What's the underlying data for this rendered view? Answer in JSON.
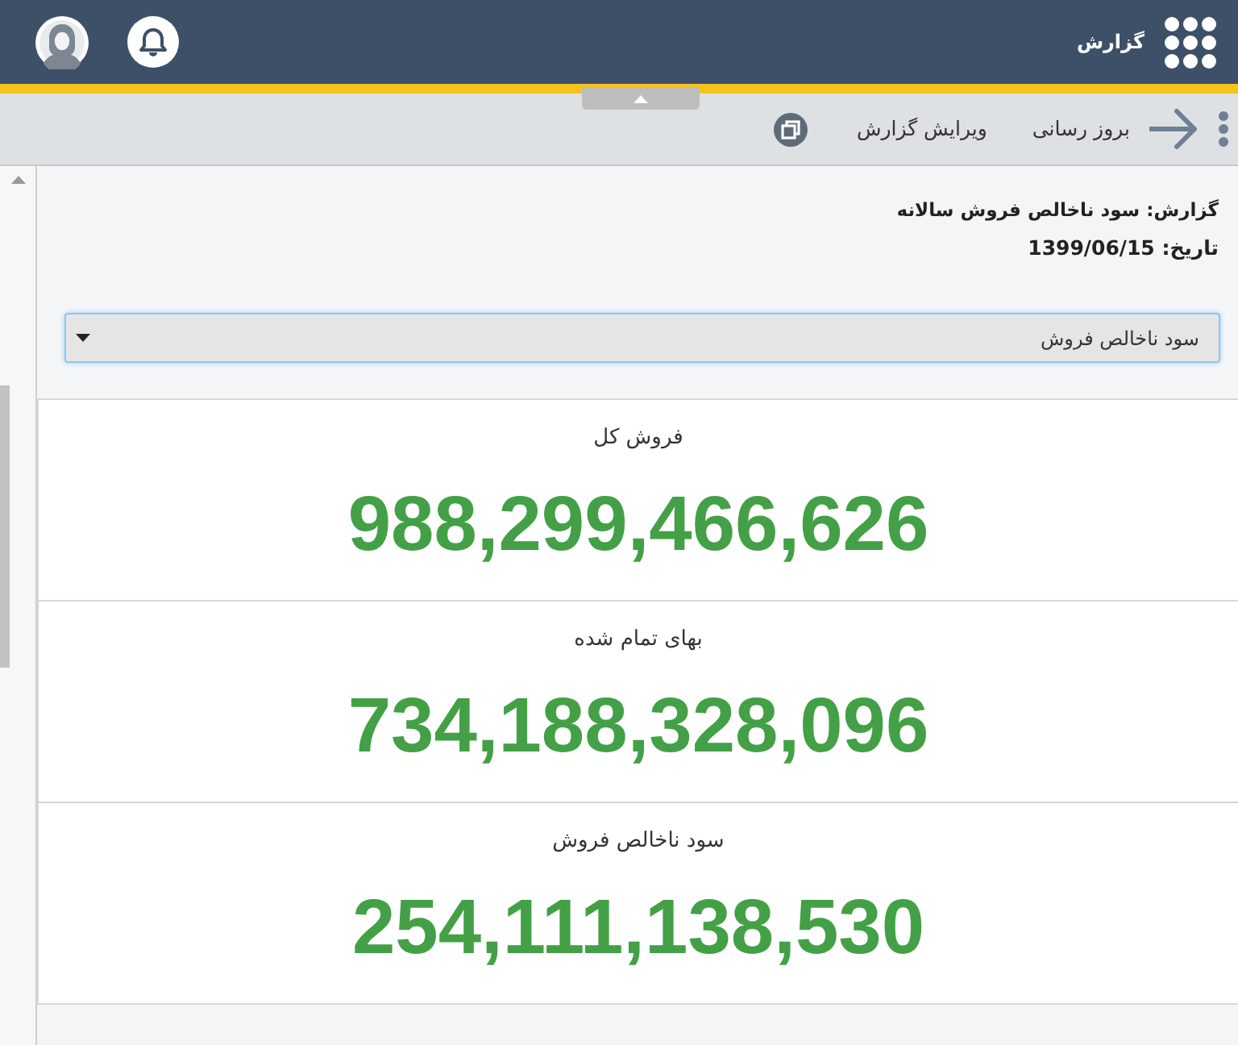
{
  "header": {
    "title": "گزارش"
  },
  "toolbar": {
    "refresh_label": "بروز رسانی",
    "edit_label": "ویرایش گزارش"
  },
  "report": {
    "title": "گزارش: سود ناخالص فروش سالانه",
    "date": "تاریخ: 1399/06/15"
  },
  "selector": {
    "value": "سود ناخالص فروش"
  },
  "metrics": [
    {
      "label": "فروش کل",
      "value": "988,299,466,626"
    },
    {
      "label": "بهای تمام شده",
      "value": "734,188,328,096"
    },
    {
      "label": "سود ناخالص فروش",
      "value": "254,111,138,530"
    }
  ]
}
